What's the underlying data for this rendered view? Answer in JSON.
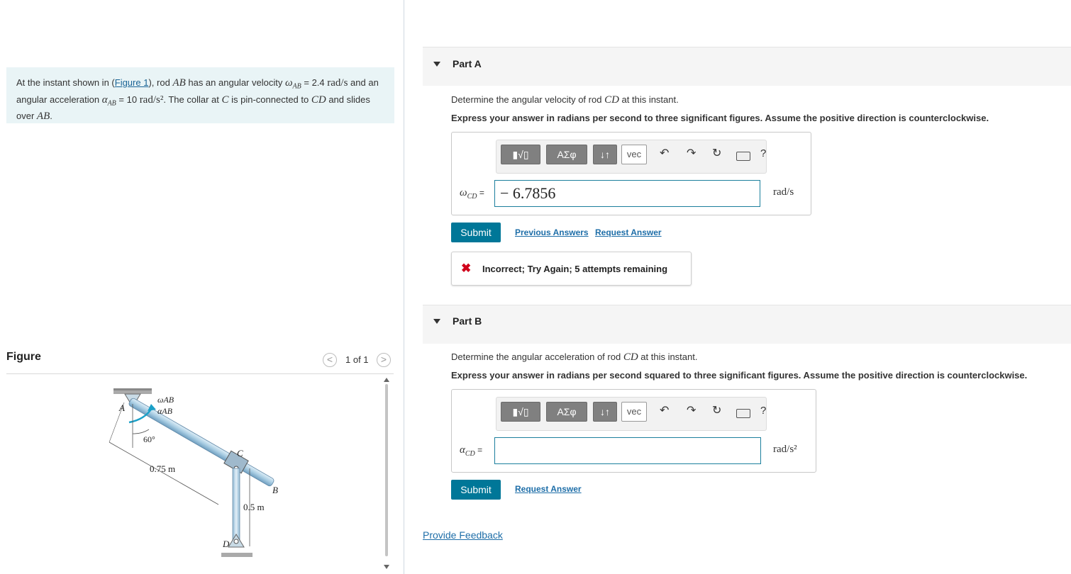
{
  "problem": {
    "text_1": "At the instant shown in (",
    "figure_link": "Figure 1",
    "text_2": "), rod ",
    "rod_ab": "AB",
    "text_3": " has an angular velocity ",
    "omega": "ω",
    "ab_sub": "AB",
    "text_4": " = 2.4 ",
    "unit_1": "rad/s",
    "text_5": " and an angular acceleration ",
    "alpha": "α",
    "text_6": " = 10 ",
    "unit_2": "rad/s²",
    "text_7": ". The collar at ",
    "c": "C",
    "text_8": " is pin-connected to ",
    "cd": "CD",
    "text_9": " and slides over ",
    "ab_end": "AB",
    "text_10": "."
  },
  "figure": {
    "label": "Figure",
    "counter": "1 of 1",
    "prev": "<",
    "next": ">",
    "labels": {
      "a": "A",
      "b": "B",
      "c": "C",
      "d": "D",
      "omega_ab": "ωAB",
      "alpha_ab": "αAB",
      "angle": "60°",
      "len_ab": "0.75 m",
      "len_cd": "0.5 m"
    }
  },
  "part_a": {
    "title": "Part A",
    "question_1": "Determine the angular velocity of rod ",
    "question_cd": "CD",
    "question_2": " at this instant.",
    "instruction": "Express your answer in radians per second to three significant figures. Assume the positive direction is counterclockwise.",
    "var_symbol": "ω",
    "var_sub": "CD",
    "var_eq": " =",
    "answer_value": "− 6.7856",
    "unit": "rad/s",
    "submit": "Submit",
    "previous_answers": "Previous Answers",
    "request_answer": "Request Answer",
    "feedback_icon": "✖",
    "feedback_text": "Incorrect; Try Again; 5 attempts remaining"
  },
  "part_b": {
    "title": "Part B",
    "question_1": "Determine the angular acceleration of rod ",
    "question_cd": "CD",
    "question_2": " at this instant.",
    "instruction": "Express your answer in radians per second squared to three significant figures. Assume the positive direction is counterclockwise.",
    "var_symbol": "α",
    "var_sub": "CD",
    "var_eq": " =",
    "answer_value": "",
    "unit": "rad/s²",
    "submit": "Submit",
    "request_answer": "Request Answer"
  },
  "toolbar": {
    "greek": "ΑΣφ",
    "arrows": "↓↑",
    "vec": "vec",
    "help": "?"
  },
  "footer": {
    "provide_feedback": "Provide Feedback"
  },
  "colors": {
    "submit_bg": "#007798",
    "problem_bg": "#e9f4f6",
    "error_red": "#d0021b",
    "link": "#1e6ea8"
  }
}
